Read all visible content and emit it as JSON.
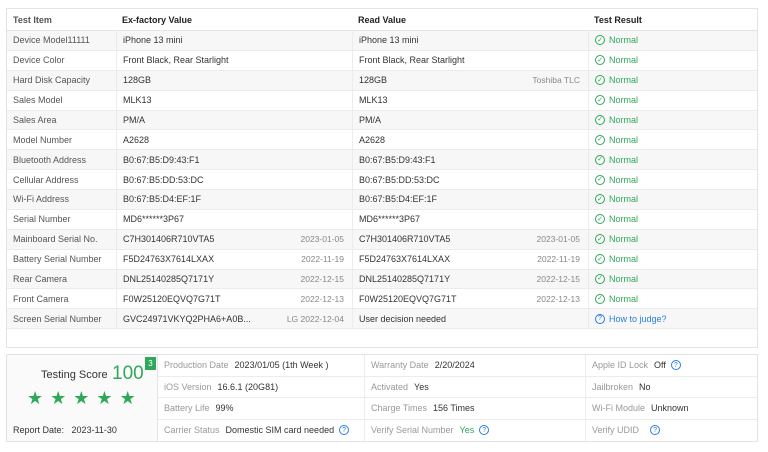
{
  "table": {
    "headers": [
      "Test Item",
      "Ex-factory Value",
      "Read Value",
      "Test Result"
    ],
    "rows": [
      {
        "item": "Device Model11111",
        "ex": "iPhone 13 mini",
        "ex_sub": "",
        "read": "iPhone 13 mini",
        "read_sub": "",
        "result": "Normal",
        "type": "ok"
      },
      {
        "item": "Device Color",
        "ex": "Front Black,  Rear Starlight",
        "ex_sub": "",
        "read": "Front Black,  Rear Starlight",
        "read_sub": "",
        "result": "Normal",
        "type": "ok"
      },
      {
        "item": "Hard Disk Capacity",
        "ex": "128GB",
        "ex_sub": "",
        "read": "128GB",
        "read_sub": "Toshiba TLC",
        "result": "Normal",
        "type": "ok"
      },
      {
        "item": "Sales Model",
        "ex": "MLK13",
        "ex_sub": "",
        "read": "MLK13",
        "read_sub": "",
        "result": "Normal",
        "type": "ok"
      },
      {
        "item": "Sales Area",
        "ex": "PM/A",
        "ex_sub": "",
        "read": "PM/A",
        "read_sub": "",
        "result": "Normal",
        "type": "ok"
      },
      {
        "item": "Model Number",
        "ex": "A2628",
        "ex_sub": "",
        "read": "A2628",
        "read_sub": "",
        "result": "Normal",
        "type": "ok"
      },
      {
        "item": "Bluetooth Address",
        "ex": "B0:67:B5:D9:43:F1",
        "ex_sub": "",
        "read": "B0:67:B5:D9:43:F1",
        "read_sub": "",
        "result": "Normal",
        "type": "ok"
      },
      {
        "item": "Cellular Address",
        "ex": "B0:67:B5:DD:53:DC",
        "ex_sub": "",
        "read": "B0:67:B5:DD:53:DC",
        "read_sub": "",
        "result": "Normal",
        "type": "ok"
      },
      {
        "item": "Wi-Fi Address",
        "ex": "B0:67:B5:D4:EF:1F",
        "ex_sub": "",
        "read": "B0:67:B5:D4:EF:1F",
        "read_sub": "",
        "result": "Normal",
        "type": "ok"
      },
      {
        "item": "Serial Number",
        "ex": "MD6******3P67",
        "ex_sub": "",
        "read": "MD6******3P67",
        "read_sub": "",
        "result": "Normal",
        "type": "ok"
      },
      {
        "item": "Mainboard Serial No.",
        "ex": "C7H301406R710VTA5",
        "ex_sub": "2023-01-05",
        "read": "C7H301406R710VTA5",
        "read_sub": "2023-01-05",
        "result": "Normal",
        "type": "ok"
      },
      {
        "item": "Battery Serial Number",
        "ex": "F5D24763X7614LXAX",
        "ex_sub": "2022-11-19",
        "read": "F5D24763X7614LXAX",
        "read_sub": "2022-11-19",
        "result": "Normal",
        "type": "ok"
      },
      {
        "item": "Rear Camera",
        "ex": "DNL25140285Q7171Y",
        "ex_sub": "2022-12-15",
        "read": "DNL25140285Q7171Y",
        "read_sub": "2022-12-15",
        "result": "Normal",
        "type": "ok"
      },
      {
        "item": "Front Camera",
        "ex": "F0W25120EQVQ7G71T",
        "ex_sub": "2022-12-13",
        "read": "F0W25120EQVQ7G71T",
        "read_sub": "2022-12-13",
        "result": "Normal",
        "type": "ok"
      },
      {
        "item": "Screen Serial Number",
        "ex": "GVC24971VKYQ2PHA6+A0B...",
        "ex_sub": "LG 2022-12-04",
        "read": "User decision needed",
        "read_sub": "",
        "result": "How to judge?",
        "type": "judge"
      }
    ]
  },
  "score": {
    "label": "Testing Score",
    "value": "100",
    "badge": "3",
    "stars": 5,
    "report_date_label": "Report Date:",
    "report_date": "2023-11-30"
  },
  "info": [
    {
      "k": "Production Date",
      "v": "2023/01/05 (1th Week )",
      "green": false,
      "q": false
    },
    {
      "k": "Warranty Date",
      "v": "2/20/2024",
      "green": false,
      "q": false
    },
    {
      "k": "Apple ID Lock",
      "v": "Off",
      "green": false,
      "q": true
    },
    {
      "k": "iOS Version",
      "v": "16.6.1 (20G81)",
      "green": false,
      "q": false
    },
    {
      "k": "Activated",
      "v": "Yes",
      "green": false,
      "q": false
    },
    {
      "k": "Jailbroken",
      "v": "No",
      "green": false,
      "q": false
    },
    {
      "k": "Battery Life",
      "v": "99%",
      "green": false,
      "q": false
    },
    {
      "k": "Charge Times",
      "v": "156 Times",
      "green": false,
      "q": false
    },
    {
      "k": "Wi-Fi Module",
      "v": "Unknown",
      "green": false,
      "q": false
    },
    {
      "k": "Carrier Status",
      "v": "Domestic SIM card needed",
      "green": false,
      "q": true
    },
    {
      "k": "Verify Serial Number",
      "v": "Yes",
      "green": true,
      "q": true
    },
    {
      "k": "Verify UDID",
      "v": "",
      "green": false,
      "q": true
    }
  ],
  "icons": {
    "ok": "check-circle-icon",
    "question": "question-circle-icon",
    "star": "star-icon"
  },
  "colors": {
    "accent_green": "#2fa85a",
    "link_blue": "#2a7de1"
  }
}
